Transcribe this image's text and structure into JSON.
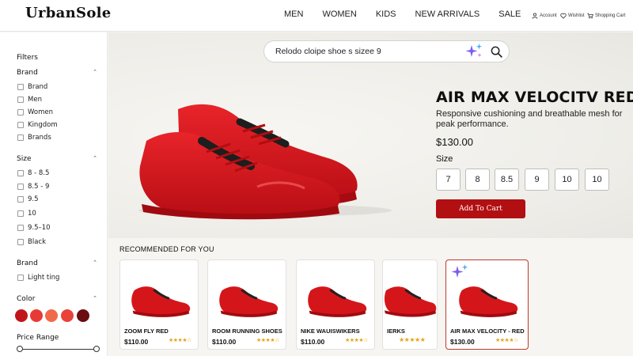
{
  "header": {
    "logo": "UrbanSole",
    "nav": [
      "MEN",
      "WOMEN",
      "KIDS",
      "NEW ARRIVALS",
      "SALE"
    ],
    "account_label": "Account",
    "wishlist_label": "Wishlist",
    "cart_label": "Shopping Cart"
  },
  "sidebar": {
    "title": "Filters",
    "brand": {
      "heading": "Brand",
      "options": [
        "Brand",
        "Men",
        "Women",
        "Kingdom",
        "Brands"
      ]
    },
    "size": {
      "heading": "Size",
      "options": [
        "8 - 8.5",
        "8.5 - 9",
        "9.5",
        "10",
        "9.5–10",
        "Black"
      ]
    },
    "brand2": {
      "heading": "Brand",
      "options": [
        "Light ting"
      ]
    },
    "color": {
      "heading": "Color",
      "swatches": [
        "#c0151b",
        "#e83a35",
        "#f06a4a",
        "#e8423a",
        "#6a0c10"
      ]
    },
    "price": {
      "heading": "Price Range"
    }
  },
  "search": {
    "value": "Relodo cloipe shoe s sizee 9"
  },
  "product": {
    "title": "AIR MAX VELOCITV RED",
    "description": "Responsive cushioning and breathable mesh for peak performance.",
    "price": "$130.00",
    "size_label": "Size",
    "sizes": [
      "7",
      "8",
      "8.5",
      "9",
      "10",
      "10"
    ],
    "cart_button": "Add To Cart",
    "color": "#d41216"
  },
  "recommended": {
    "title": "RECOMMENDED FOR YOU",
    "items": [
      {
        "name": "ZOOM FLY RED",
        "price": "$110.00",
        "rating": 4.5,
        "stars": "★★★★☆"
      },
      {
        "name": "ROOM RUNNING SHOES",
        "price": "$110.00",
        "rating": 4.5,
        "stars": "★★★★☆"
      },
      {
        "name": "NIKE WAUISWIKERS",
        "price": "$110.00",
        "rating": 4.5,
        "stars": "★★★★☆"
      },
      {
        "name": "IERKS",
        "price": "",
        "rating": 5,
        "stars": "★★★★★"
      },
      {
        "name": "AIR MAX VELOCITY - RED",
        "price": "$130.00",
        "rating": 4.5,
        "stars": "★★★★☆"
      }
    ]
  },
  "colors": {
    "accent": "#b20f12",
    "shoe_red": "#d41216",
    "star": "#e3a21a"
  }
}
